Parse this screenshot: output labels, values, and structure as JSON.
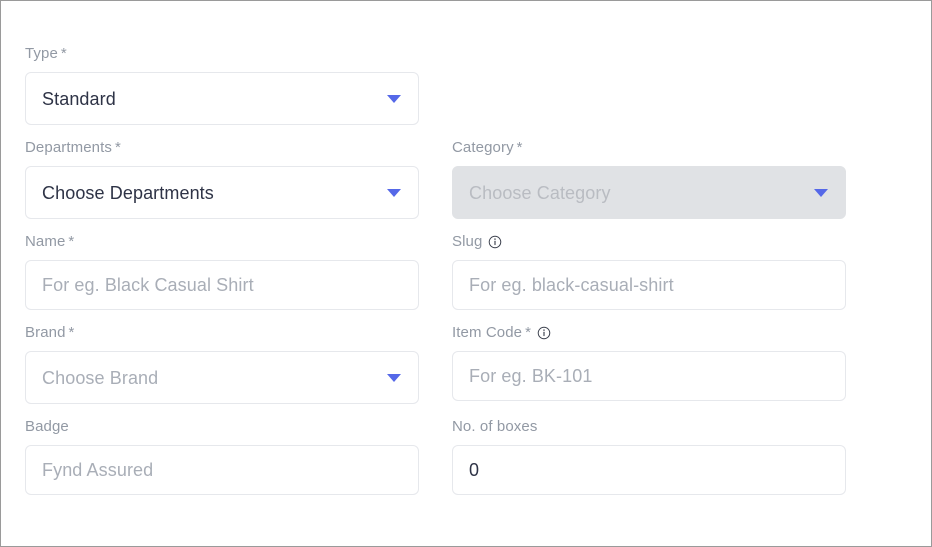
{
  "form": {
    "rows": [
      {
        "left": {
          "label": "Type",
          "required": true,
          "info": false,
          "control": "select",
          "value": "Standard",
          "is_placeholder": false,
          "disabled": false,
          "name": "type"
        },
        "right": null
      },
      {
        "left": {
          "label": "Departments",
          "required": true,
          "info": false,
          "control": "select",
          "value": "Choose Departments",
          "is_placeholder": false,
          "disabled": false,
          "name": "departments"
        },
        "right": {
          "label": "Category",
          "required": true,
          "info": false,
          "control": "select",
          "value": "Choose Category",
          "is_placeholder": true,
          "disabled": true,
          "name": "category"
        }
      },
      {
        "left": {
          "label": "Name",
          "required": true,
          "info": false,
          "control": "input",
          "value": "",
          "placeholder": "For eg. Black Casual Shirt",
          "is_placeholder": true,
          "disabled": false,
          "name": "name"
        },
        "right": {
          "label": "Slug",
          "required": false,
          "info": true,
          "control": "input",
          "value": "",
          "placeholder": "For eg. black-casual-shirt",
          "is_placeholder": true,
          "disabled": false,
          "name": "slug"
        }
      },
      {
        "left": {
          "label": "Brand",
          "required": true,
          "info": false,
          "control": "select",
          "value": "Choose Brand",
          "is_placeholder": true,
          "disabled": false,
          "name": "brand"
        },
        "right": {
          "label": "Item Code",
          "required": true,
          "info": true,
          "control": "input",
          "value": "",
          "placeholder": "For eg. BK-101",
          "is_placeholder": true,
          "disabled": false,
          "name": "item-code"
        }
      },
      {
        "left": {
          "label": "Badge",
          "required": false,
          "info": false,
          "control": "input",
          "value": "",
          "placeholder": "Fynd Assured",
          "is_placeholder": true,
          "disabled": false,
          "name": "badge"
        },
        "right": {
          "label": "No. of boxes",
          "required": false,
          "info": false,
          "control": "input",
          "value": "0",
          "placeholder": "0",
          "is_placeholder": false,
          "disabled": false,
          "name": "no-of-boxes"
        }
      }
    ],
    "required_marker": "*",
    "icons": {
      "info": "info-icon",
      "caret": "chevron-down-icon"
    },
    "colors": {
      "label": "#9299a4",
      "value": "#2e3346",
      "placeholder": "#a9aeb7",
      "caret": "#5568e8",
      "border": "#e6e8ec",
      "disabled_bg": "#e0e2e5",
      "disabled_text": "#b9bcc2"
    }
  }
}
